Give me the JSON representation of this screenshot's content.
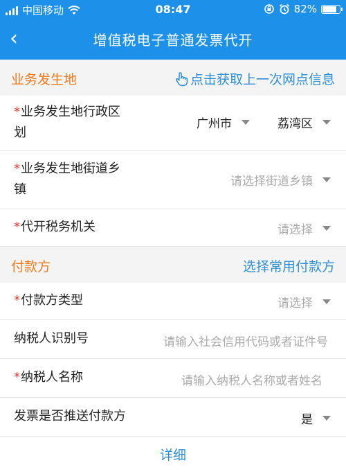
{
  "status": {
    "carrier": "中国移动",
    "time": "08:47",
    "battery": "82%",
    "battery_level": 0.82
  },
  "nav": {
    "back_symbol": "‹",
    "title": "增值税电子普通发票代开"
  },
  "business_section": {
    "label": "业务发生地",
    "action": "点击获取上一次网点信息"
  },
  "rows": {
    "district": {
      "required": "*",
      "label_line1": "业务发生地行政区",
      "label_line2": "划",
      "city": "广州市",
      "district": "荔湾区"
    },
    "street": {
      "required": "*",
      "label_line1": "业务发生地街道乡",
      "label_line2": "镇",
      "placeholder": "请选择街道乡镇"
    },
    "tax_office": {
      "required": "*",
      "label": "代开税务机关",
      "placeholder": "请选择"
    }
  },
  "payer_section": {
    "label": "付款方",
    "action": "选择常用付款方"
  },
  "payer_rows": {
    "type": {
      "required": "*",
      "label": "付款方类型",
      "placeholder": "请选择"
    },
    "taxpayer_id": {
      "label": "纳税人识别号",
      "placeholder": "请输入社会信用代码或者证件号"
    },
    "taxpayer_name": {
      "required": "*",
      "label": "纳税人名称",
      "placeholder": "请输入纳税人名称或者姓名"
    },
    "push_invoice": {
      "label": "发票是否推送付款方",
      "value": "是"
    }
  },
  "footer": {
    "detail": "详细"
  }
}
